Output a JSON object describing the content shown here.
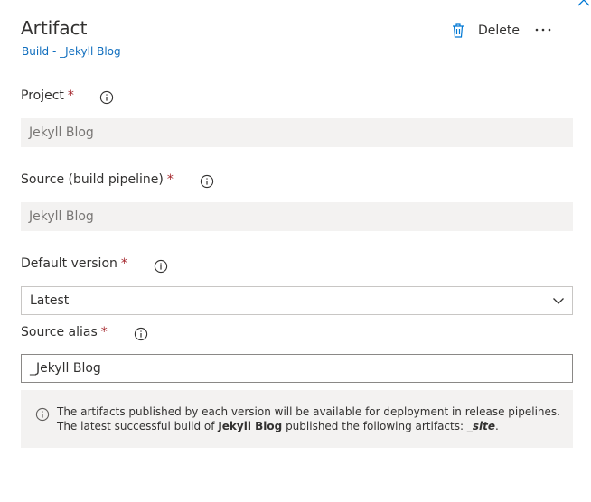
{
  "panel": {
    "title": "Artifact",
    "subtitle": "Build - _Jekyll Blog",
    "delete_label": "Delete"
  },
  "fields": {
    "project": {
      "label": "Project",
      "required_mark": "*",
      "value": "Jekyll Blog"
    },
    "source": {
      "label": "Source (build pipeline)",
      "required_mark": "*",
      "value": "Jekyll Blog"
    },
    "default_version": {
      "label": "Default version",
      "required_mark": "*",
      "selected": "Latest"
    },
    "source_alias": {
      "label": "Source alias",
      "required_mark": "*",
      "value": "_Jekyll Blog"
    }
  },
  "info": {
    "line1": "The artifacts published by each version will be available for deployment in release pipelines.",
    "line2_prefix": "The latest successful build of",
    "line2_build": "Jekyll Blog",
    "line2_middle": "published the following artifacts:",
    "line2_artifact": "_site",
    "line2_suffix": "."
  },
  "colors": {
    "accent": "#106ebe",
    "required": "#a4262c",
    "field_disabled_bg": "#f3f2f1",
    "text": "#323130"
  },
  "icons": [
    "trash-icon",
    "more-icon",
    "info-icon",
    "chevron-down-icon",
    "close-icon"
  ]
}
